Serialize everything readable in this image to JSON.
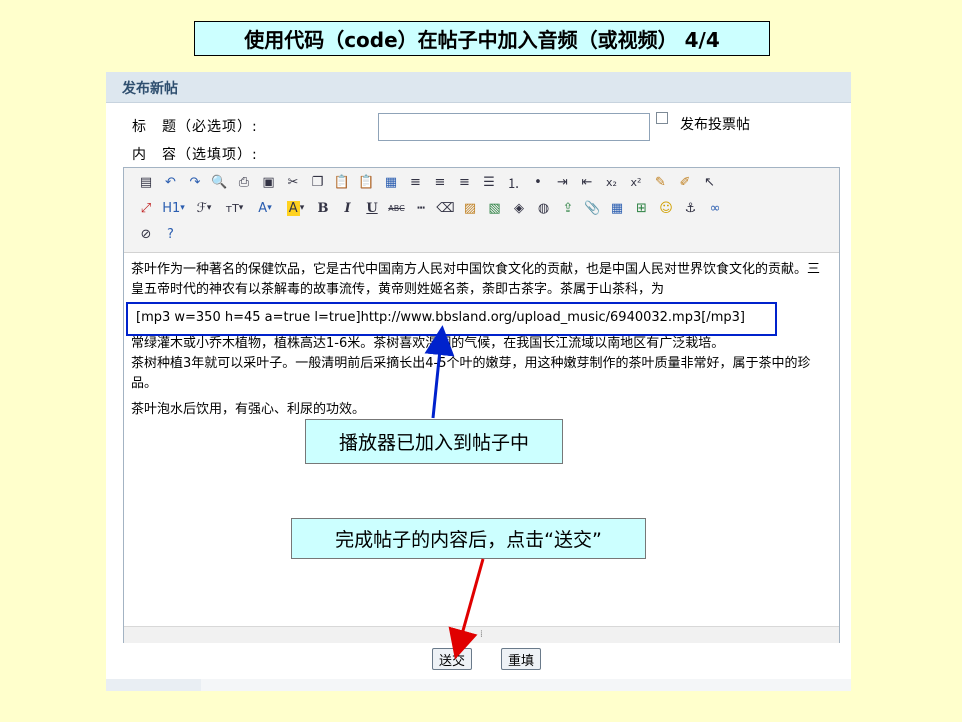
{
  "slide": {
    "title": "使用代码（code）在帖子中加入音频（或视频） 4/4"
  },
  "form": {
    "header": "发布新帖",
    "title_label": "标　题（必选项）:",
    "content_label": "内　容（选填项）:",
    "title_value": "",
    "poll_label": "发布投票帖"
  },
  "toolbar": {
    "heading": "H1",
    "font": "ℱ",
    "size": "тT",
    "font_color": "A",
    "highlight": "A",
    "bold": "B",
    "italic": "I",
    "underline": "U",
    "strike": "ABC"
  },
  "content": {
    "para1": "茶叶作为一种著名的保健饮品，它是古代中国南方人民对中国饮食文化的贡献，也是中国人民对世界饮食文化的贡献。三皇五帝时代的神农有以茶解毒的故事流传，黄帝则姓姬名荼，荼即古茶字。茶属于山茶科，为",
    "para2": "常绿灌木或小乔木植物，植株高达1-6米。茶树喜欢湿润的气候，在我国长江流域以南地区有广泛栽培。",
    "para3": "茶树种植3年就可以采叶子。一般清明前后采摘长出4-5个叶的嫩芽，用这种嫩芽制作的茶叶质量非常好，属于茶中的珍品。",
    "para4": "茶叶泡水后饮用，有强心、利尿的功效。",
    "code": "[mp3 w=350 h=45 a=true l=true]http://www.bbsland.org/upload_music/6940032.mp3[/mp3]"
  },
  "callouts": {
    "player": "播放器已加入到帖子中",
    "submit_hint": "完成帖子的内容后，点击“送交”"
  },
  "buttons": {
    "submit": "送交",
    "reset": "重填"
  },
  "colors": {
    "slide_bg": "#ffffcc",
    "callout_bg": "#ccffff",
    "highlight_box": "#0022cc",
    "arrow_blue": "#0022cc",
    "arrow_red": "#e00000"
  }
}
